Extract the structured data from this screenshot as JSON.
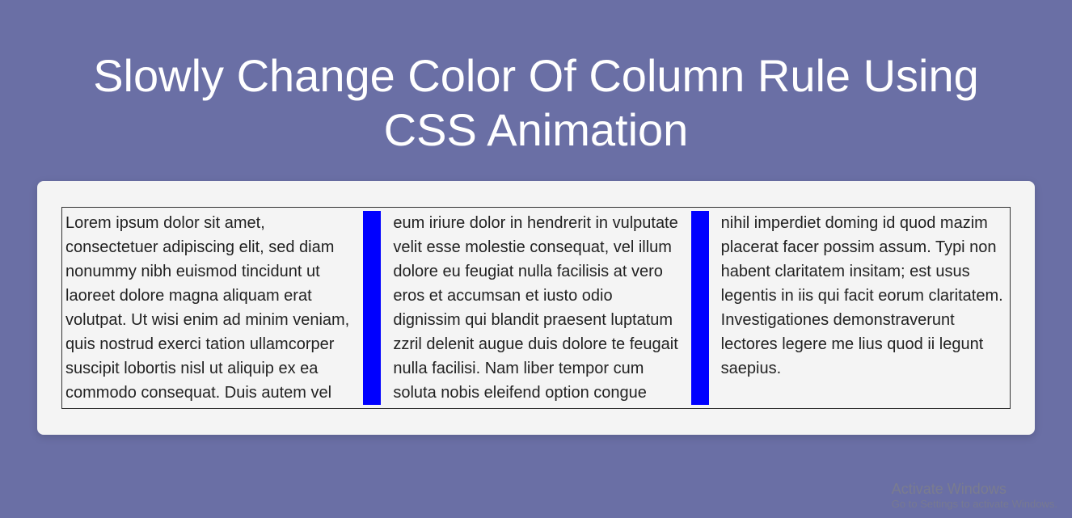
{
  "page": {
    "title": "Slowly Change Color Of Column Rule Using CSS Animation"
  },
  "content": {
    "paragraph": "Lorem ipsum dolor sit amet, consectetuer adipiscing elit, sed diam nonummy nibh euismod tincidunt ut laoreet dolore magna aliquam erat volutpat. Ut wisi enim ad minim veniam, quis nostrud exerci tation ullamcorper suscipit lobortis nisl ut aliquip ex ea commodo consequat. Duis autem vel eum iriure dolor in hendrerit in vulputate velit esse molestie consequat, vel illum dolore eu feugiat nulla facilisis at vero eros et accumsan et iusto odio dignissim qui blandit praesent luptatum zzril delenit augue duis dolore te feugait nulla facilisi. Nam liber tempor cum soluta nobis eleifend option congue nihil imperdiet doming id quod mazim placerat facer possim assum. Typi non habent claritatem insitam; est usus legentis in iis qui facit eorum claritatem. Investigationes demonstraverunt lectores legere me lius quod ii legunt saepius."
  },
  "watermark": {
    "title": "Activate Windows",
    "subtitle": "Go to Settings to activate Windows."
  },
  "colors": {
    "background": "#6a6fa5",
    "card": "#f4f4f4",
    "rule_initial": "#0000ff"
  }
}
